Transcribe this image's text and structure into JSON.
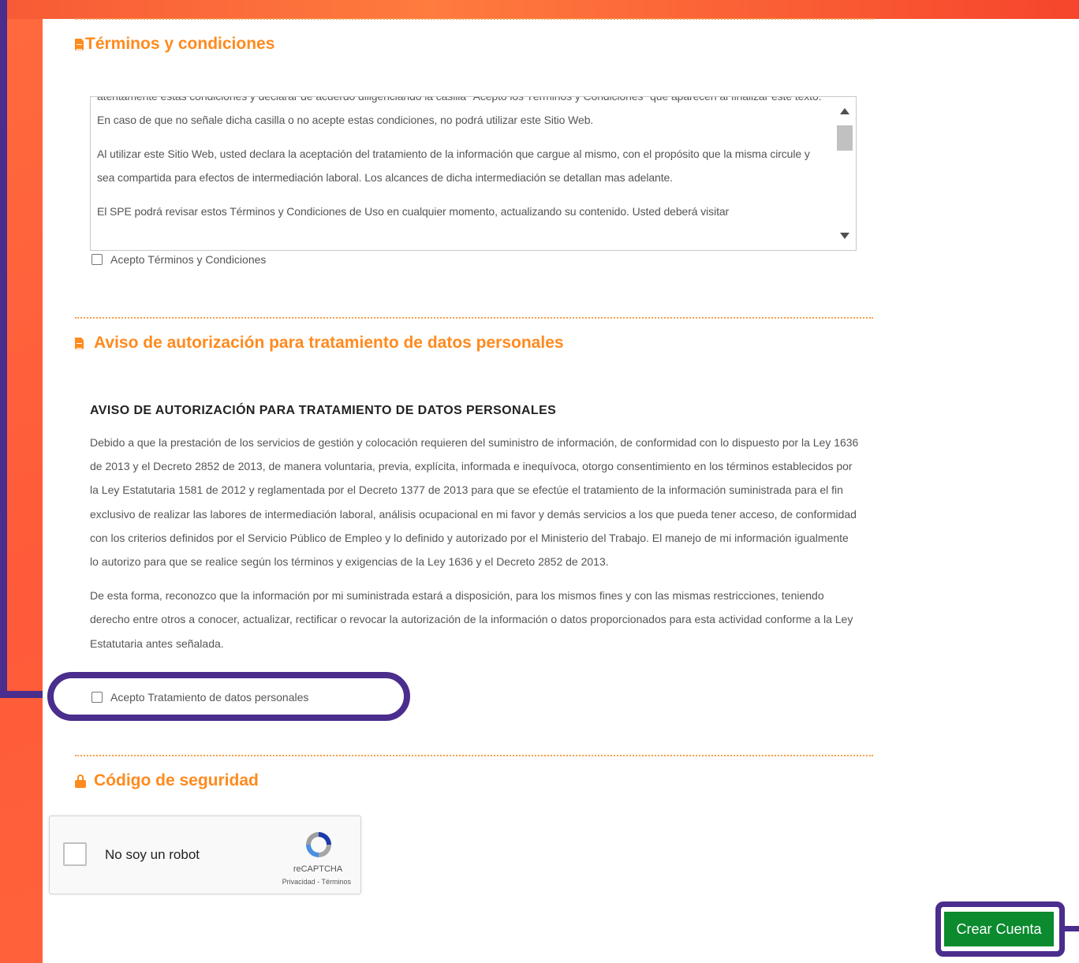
{
  "terms": {
    "title": "Términos y condiciones",
    "text": [
      "atentamente estas condiciones y declarar de acuerdo diligenciando la casilla \"Acepto los Términos y Condiciones\" que aparecen al finalizar este texto. En caso de que no señale dicha casilla o no acepte estas condiciones, no podrá utilizar este Sitio Web.",
      "Al utilizar este Sitio Web, usted declara la aceptación del tratamiento de la información que cargue al mismo, con el propósito que la misma circule y sea compartida para efectos de intermediación laboral. Los alcances de dicha intermediación se detallan mas adelante.",
      "El SPE podrá revisar estos Términos y Condiciones de Uso en cualquier momento, actualizando su contenido. Usted deberá visitar"
    ],
    "accept_label": "Acepto Términos y Condiciones"
  },
  "data_notice": {
    "title": "Aviso de autorización para tratamiento de datos personales",
    "heading": "AVISO DE AUTORIZACIÓN PARA TRATAMIENTO DE DATOS PERSONALES",
    "paragraphs": [
      "Debido a que la prestación de los servicios de gestión y colocación requieren del suministro de información, de conformidad con lo dispuesto por la Ley 1636 de 2013 y el Decreto 2852 de 2013, de manera voluntaria, previa, explícita, informada e inequívoca, otorgo consentimiento en los términos establecidos por la Ley Estatutaria 1581 de 2012 y reglamentada por el Decreto 1377 de 2013 para que se efectúe el tratamiento de la información suministrada para el fin exclusivo de realizar las labores de intermediación laboral, análisis ocupacional en mi favor y demás servicios a los que pueda tener acceso, de conformidad con los criterios definidos por el Servicio Público de Empleo y lo definido y autorizado por el Ministerio del Trabajo. El manejo de mi información igualmente lo autorizo para que se realice según los términos y exigencias de la Ley 1636 y el Decreto 2852 de 2013.",
      "De esta forma, reconozco que la información por mi suministrada estará a disposición, para los mismos fines y con las mismas restricciones, teniendo derecho entre otros a conocer, actualizar, rectificar o revocar la autorización de la información o datos proporcionados para esta actividad conforme a la Ley Estatutaria antes señalada."
    ],
    "accept_label": "Acepto Tratamiento de datos personales"
  },
  "security": {
    "title": "Código de seguridad",
    "recaptcha_label": "No soy un robot",
    "recaptcha_brand": "reCAPTCHA",
    "recaptcha_links": "Privacidad - Términos"
  },
  "actions": {
    "create_account": "Crear Cuenta"
  },
  "colors": {
    "section_title": "#ff8a1e",
    "annotation": "#4a2d8c",
    "button": "#0b8a2e"
  }
}
